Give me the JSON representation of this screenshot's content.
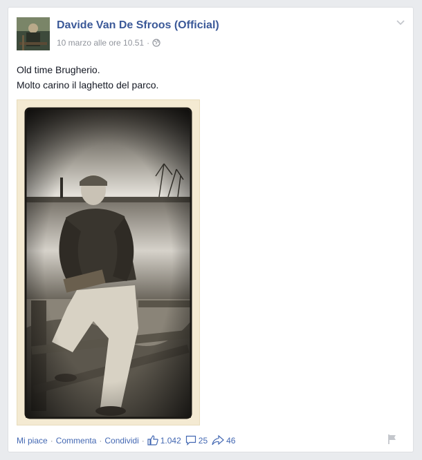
{
  "post": {
    "author": "Davide Van De Sfroos (Official)",
    "timestamp": "10 marzo alle ore 10.51",
    "meta_separator": "·",
    "privacy_icon": "globe-icon",
    "menu_icon": "chevron-down-icon",
    "text_lines": [
      "Old time Brugherio.",
      "Molto carino il laghetto del parco."
    ],
    "photo_description": "sepia-photo"
  },
  "actions": {
    "like": "Mi piace",
    "comment": "Commenta",
    "share": "Condividi",
    "separator": "·"
  },
  "stats": {
    "likes": "1.042",
    "comments": "25",
    "shares": "46"
  },
  "colors": {
    "link": "#4267b2",
    "author": "#3b5998",
    "meta": "#90949c",
    "card_bg": "#ffffff",
    "page_bg": "#e9ebee"
  }
}
